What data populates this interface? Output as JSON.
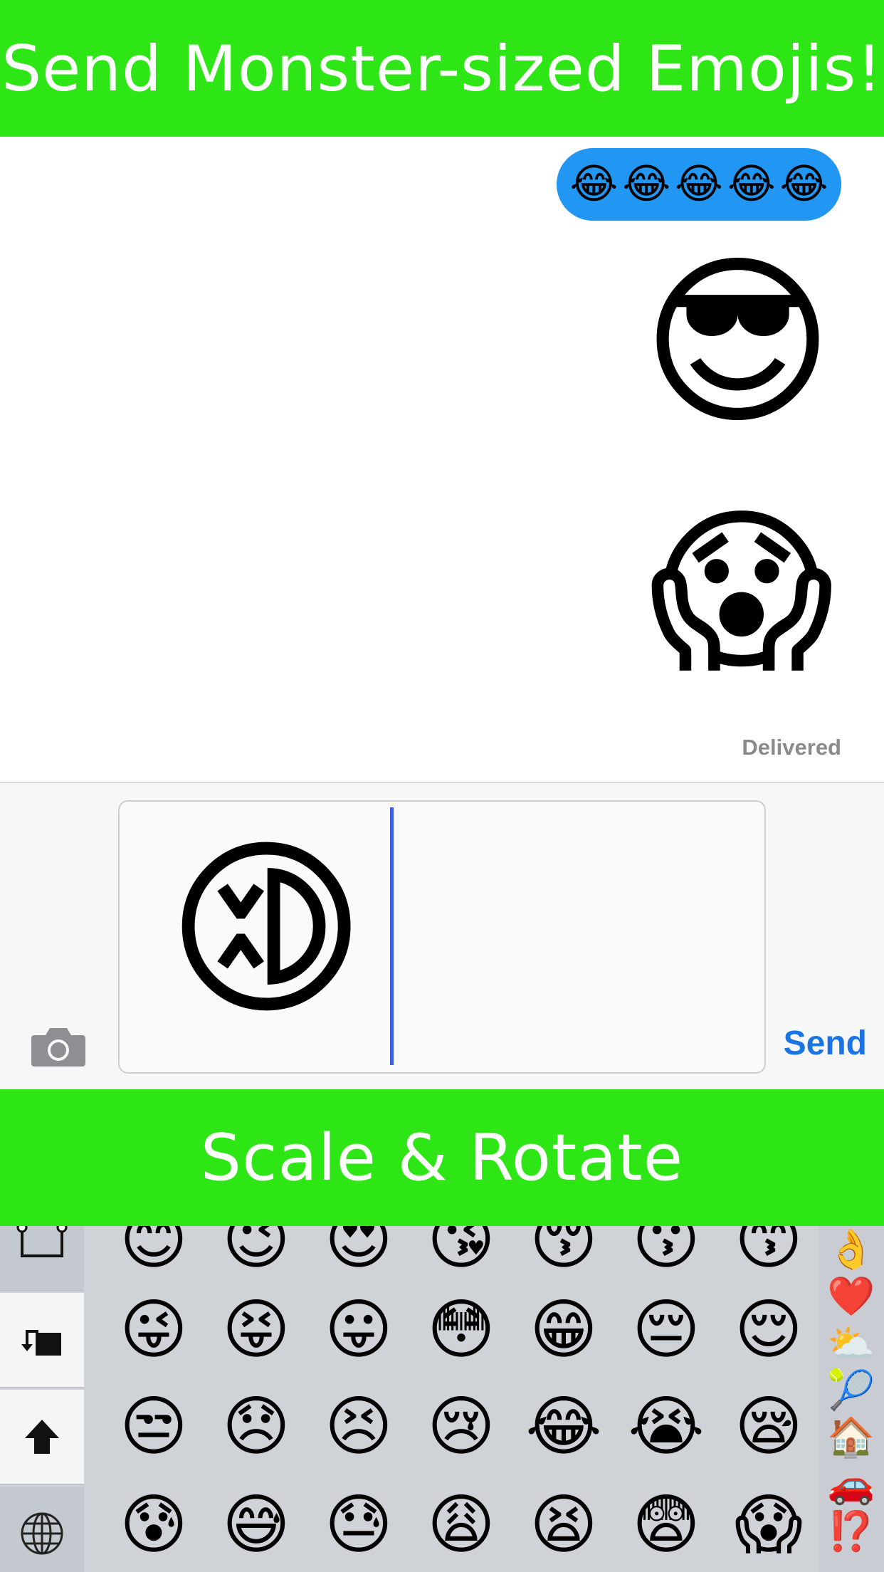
{
  "top_banner": {
    "text": "Send Monster-sized Emojis!"
  },
  "mid_banner": {
    "text": "Scale & Rotate"
  },
  "messages": {
    "bubble_emojis": [
      "😂",
      "😂",
      "😂",
      "😂",
      "😂"
    ],
    "big_emoji_1": "😎",
    "big_emoji_2": "😱",
    "status": "Delivered"
  },
  "input": {
    "emoji": "😆",
    "send_label": "Send"
  },
  "keyboard": {
    "left_keys": [
      "share-icon",
      "rotate-icon",
      "shift-icon",
      "globe-icon"
    ],
    "rows": [
      [
        "😊",
        "😉",
        "😍",
        "😘",
        "😚",
        "😗",
        "😙"
      ],
      [
        "😜",
        "😝",
        "😛",
        "😳",
        "😁",
        "😔",
        "😌"
      ],
      [
        "😒",
        "😞",
        "😣",
        "😢",
        "😂",
        "😭",
        "😪"
      ],
      [
        "😰",
        "😅",
        "😓",
        "😩",
        "😫",
        "😨",
        "😱"
      ]
    ],
    "categories": [
      "👌",
      "❤️",
      "⛅",
      "🎾",
      "🏠",
      "🚗",
      "⁉️"
    ]
  },
  "colors": {
    "banner_green": "#2ee516",
    "bubble_blue": "#2196f3",
    "send_blue": "#1b74e4",
    "cursor_blue": "#3d5fe0"
  }
}
